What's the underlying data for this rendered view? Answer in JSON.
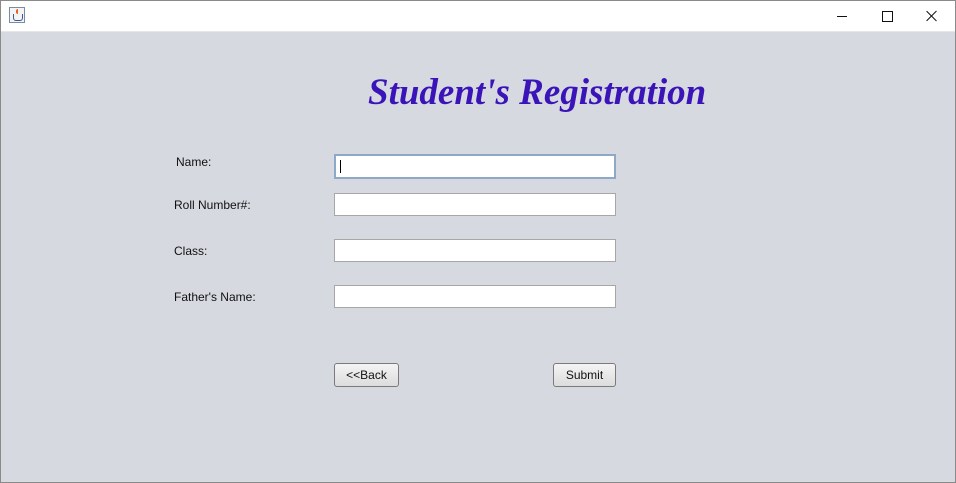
{
  "window": {
    "icon": "java-app-icon",
    "controls": [
      "minimize-icon",
      "maximize-icon",
      "close-icon"
    ]
  },
  "form": {
    "title": "Student's Registration",
    "fields": [
      {
        "label": "Name:",
        "value": ""
      },
      {
        "label": "Roll Number#:",
        "value": ""
      },
      {
        "label": "Class:",
        "value": ""
      },
      {
        "label": "Father's Name:",
        "value": ""
      }
    ],
    "back_label": "<<Back",
    "submit_label": "Submit"
  },
  "colors": {
    "background": "#d6d9e0",
    "title": "#3a14b8"
  }
}
